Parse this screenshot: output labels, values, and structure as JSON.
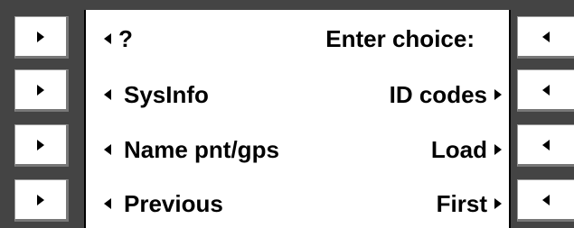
{
  "screen": {
    "line1": {
      "left": "?",
      "center": "Enter choice:"
    },
    "line2": {
      "left": "SysInfo",
      "right": "ID codes"
    },
    "line3": {
      "left": "Name pnt/gps",
      "right": "Load"
    },
    "line4": {
      "left": "Previous",
      "right": "First"
    }
  },
  "softkeys": {
    "left_icon": "triangle-right-icon",
    "right_icon": "triangle-left-icon"
  },
  "colors": {
    "bezel": "#444444",
    "screen": "#ffffff",
    "text": "#000000"
  }
}
